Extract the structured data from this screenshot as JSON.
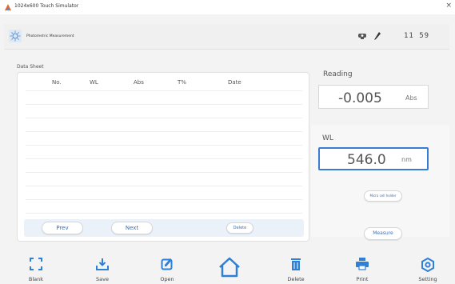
{
  "window": {
    "title": "1024x600 Touch Simulator",
    "close_glyph": "×"
  },
  "header": {
    "app_title": "Photometric Measurement",
    "clock": "11 59",
    "icons": [
      "lamp-icon",
      "pen-icon"
    ]
  },
  "sheet": {
    "label": "Data Sheet",
    "columns": [
      "No.",
      "WL",
      "Abs",
      "T%",
      "Date"
    ],
    "rows": [],
    "prev_label": "Prev",
    "next_label": "Next",
    "delete_label": "Delete"
  },
  "reading": {
    "label": "Reading",
    "value": "-0.005",
    "unit": "Abs"
  },
  "wavelength": {
    "label": "WL",
    "value": "546.0",
    "unit": "nm"
  },
  "buttons": {
    "micro_cell_label": "Micro cell holder",
    "measure_label": "Measure"
  },
  "toolbar": {
    "items": [
      {
        "label": "Blank",
        "icon": "blank-icon"
      },
      {
        "label": "Save",
        "icon": "save-icon"
      },
      {
        "label": "Open",
        "icon": "open-icon"
      },
      {
        "label": "",
        "icon": "home-icon"
      },
      {
        "label": "Delete",
        "icon": "trash-icon"
      },
      {
        "label": "Print",
        "icon": "printer-icon"
      },
      {
        "label": "Setting",
        "icon": "settings-icon"
      }
    ]
  },
  "colors": {
    "accent": "#3a7bd5",
    "button_text": "#3c6fb4",
    "background": "#f3f3f3"
  }
}
